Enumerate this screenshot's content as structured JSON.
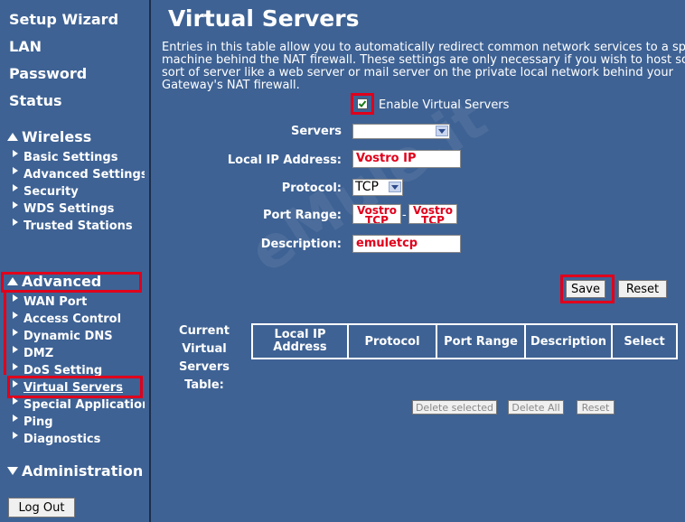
{
  "sidebar": {
    "top_links": [
      "Setup Wizard",
      "LAN",
      "Password",
      "Status"
    ],
    "wireless": {
      "title": "Wireless",
      "items": [
        "Basic Settings",
        "Advanced Settings",
        "Security",
        "WDS Settings",
        "Trusted Stations"
      ]
    },
    "advanced": {
      "title": "Advanced",
      "items": [
        "WAN Port",
        "Access Control",
        "Dynamic DNS",
        "DMZ",
        "DoS Setting",
        "Virtual Servers",
        "Special Applications",
        "Ping",
        "Diagnostics"
      ]
    },
    "administration": {
      "title": "Administration"
    },
    "logout_label": "Log Out"
  },
  "main": {
    "title": "Virtual Servers",
    "description": "Entries in this table allow you to automatically redirect common network services to a specific machine behind the NAT firewall. These settings are only necessary if you wish to host some sort of server like a web server or mail server on the private local network behind your Gateway's NAT firewall.",
    "enable_label": "Enable Virtual Servers",
    "enable_checked": true,
    "form": {
      "servers_label": "Servers",
      "servers_value": "",
      "local_ip_label": "Local IP Address:",
      "local_ip_value": "Vostro IP",
      "protocol_label": "Protocol:",
      "protocol_value": "TCP",
      "port_range_label": "Port Range:",
      "port_from_value": "Vostro TCP",
      "port_sep": "-",
      "port_to_value": "Vostro TCP",
      "description_label": "Description:",
      "description_value": "emuletcp"
    },
    "save_label": "Save",
    "reset_label": "Reset",
    "table_caption": "Current Virtual Servers Table:",
    "table_headers": [
      "Local IP Address",
      "Protocol",
      "Port Range",
      "Description",
      "Select"
    ],
    "bottom_buttons": [
      "Delete selected",
      "Delete All",
      "Reset"
    ],
    "watermark": "eMule.it"
  },
  "colors": {
    "background": "#3e6294",
    "highlight_box": "#e0001b",
    "field_text": "#e0001b"
  }
}
